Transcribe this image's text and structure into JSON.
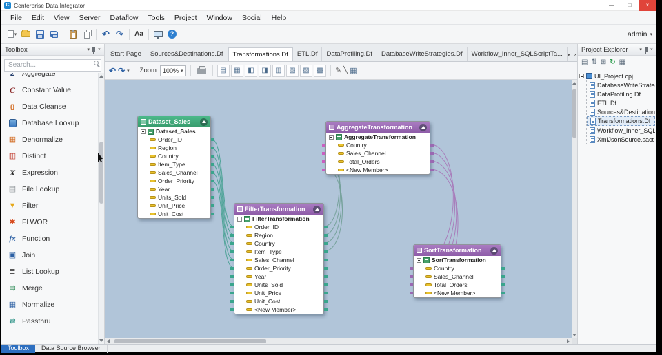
{
  "window": {
    "title": "Centerprise Data Integrator",
    "logo_glyph": "C",
    "controls": {
      "minimize": "—",
      "maximize": "□",
      "close": "×"
    }
  },
  "menu": {
    "items": [
      "File",
      "Edit",
      "View",
      "Server",
      "Dataflow",
      "Tools",
      "Project",
      "Window",
      "Social",
      "Help"
    ]
  },
  "main_toolbar": {
    "caret": "▾",
    "undo": "↶",
    "redo": "↷",
    "font": "Aa",
    "help": "?",
    "user": "admin"
  },
  "toolbox": {
    "title": "Toolbox",
    "search_placeholder": "Search...",
    "items": [
      {
        "glyph": "Σ",
        "label": "Aggregate"
      },
      {
        "glyph": "C",
        "label": "Constant Value"
      },
      {
        "glyph": "{}",
        "label": "Data Cleanse"
      },
      {
        "glyph": "",
        "label": "Database Lookup"
      },
      {
        "glyph": "▦",
        "label": "Denormalize"
      },
      {
        "glyph": "▥",
        "label": "Distinct"
      },
      {
        "glyph": "X",
        "label": "Expression"
      },
      {
        "glyph": "▤",
        "label": "File Lookup"
      },
      {
        "glyph": "▼",
        "label": "Filter"
      },
      {
        "glyph": "✱",
        "label": "FLWOR"
      },
      {
        "glyph": "fx",
        "label": "Function"
      },
      {
        "glyph": "▣",
        "label": "Join"
      },
      {
        "glyph": "≣",
        "label": "List Lookup"
      },
      {
        "glyph": "⇉",
        "label": "Merge"
      },
      {
        "glyph": "▦",
        "label": "Normalize"
      },
      {
        "glyph": "⇄",
        "label": "Passthru"
      }
    ]
  },
  "doc_tabs": {
    "items": [
      "Start Page",
      "Sources&Destinations.Df",
      "Transformations.Df",
      "ETL.Df",
      "DataProfiling.Df",
      "DatabaseWriteStrategies.Df",
      "Workflow_Inner_SQLScriptTa..."
    ],
    "active": "Transformations.Df"
  },
  "canvas_toolbar": {
    "back": "↶",
    "forward": "↷",
    "caret": "▾",
    "zoom_label": "Zoom",
    "zoom_value": "100%",
    "tools": [
      "▤",
      "▦",
      "◧",
      "◨",
      "▥",
      "▧",
      "▨",
      "▩"
    ],
    "pencil": "✎",
    "line": "╲",
    "grid": "▦"
  },
  "nodes": {
    "dataset": {
      "title": "Dataset_Sales",
      "root": "Dataset_Sales",
      "fields": [
        "Order_ID",
        "Region",
        "Country",
        "Item_Type",
        "Sales_Channel",
        "Order_Priority",
        "Year",
        "Units_Sold",
        "Unit_Price",
        "Unit_Cost"
      ]
    },
    "filter": {
      "title": "FilterTransformation",
      "root": "FilterTransformation",
      "fields": [
        "Order_ID",
        "Region",
        "Country",
        "Item_Type",
        "Sales_Channel",
        "Order_Priority",
        "Year",
        "Units_Sold",
        "Unit_Price",
        "Unit_Cost",
        "<New Member>"
      ]
    },
    "aggregate": {
      "title": "AggregateTransformation",
      "root": "AggregateTransformation",
      "fields": [
        "Country",
        "Sales_Channel",
        "Total_Orders",
        "<New Member>"
      ]
    },
    "sort": {
      "title": "SortTransformation",
      "root": "SortTransformation",
      "fields": [
        "Country",
        "Sales_Channel",
        "Total_Orders",
        "<New Member>"
      ]
    }
  },
  "project_explorer": {
    "title": "Project Explorer",
    "tools": [
      "▤",
      "⇅",
      "⊞",
      "↻",
      "▦"
    ],
    "root": "UI_Project.cpj",
    "items": [
      "DatabaseWriteStrategies.Df",
      "DataProfiling.Df",
      "ETL.Df",
      "Sources&Destinations.Df",
      "Transformations.Df",
      "Workflow_Inner_SQLScript...",
      "XmlJsonSource.sact"
    ]
  },
  "bottom_tabs": {
    "toolbox": "Toolbox",
    "data_source": "Data Source Browser"
  },
  "colors": {
    "canvas": "#b1c5d9",
    "source_header": "#3fae7e",
    "transform_header": "#9a68b2",
    "accent": "#2d6fc0",
    "teal_line": "#3d9e8c",
    "purple_line": "#a876b8"
  }
}
